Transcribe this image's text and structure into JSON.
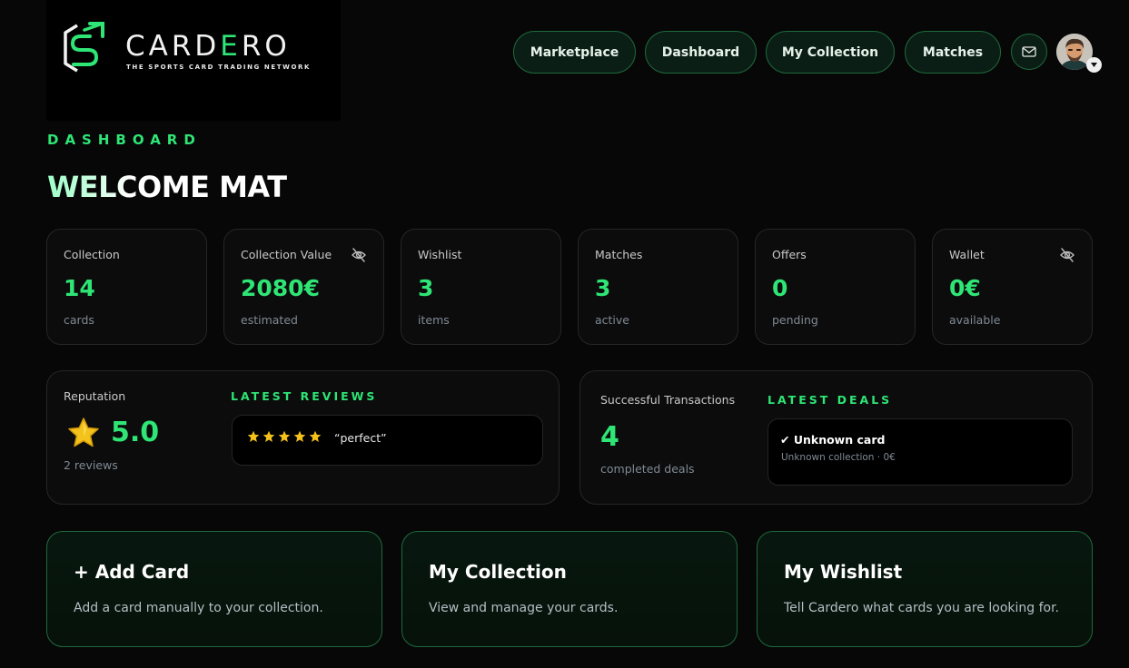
{
  "brand": {
    "name_prefix": "CARD",
    "name_accent": "E",
    "name_suffix": "RO",
    "tagline": "THE SPORTS CARD TRADING NETWORK",
    "accent_color": "#2ee575"
  },
  "nav": {
    "items": [
      {
        "label": "Marketplace"
      },
      {
        "label": "Dashboard"
      },
      {
        "label": "My Collection"
      },
      {
        "label": "Matches"
      }
    ],
    "mail_icon": "mail-icon",
    "avatar_icon": "user-avatar"
  },
  "header": {
    "eyebrow": "DASHBOARD",
    "welcome": "WELCOME MAT"
  },
  "stats": [
    {
      "label": "Collection",
      "value": "14",
      "sub": "cards",
      "icon": null
    },
    {
      "label": "Collection Value",
      "value": "2080€",
      "sub": "estimated",
      "icon": "eye-off-icon"
    },
    {
      "label": "Wishlist",
      "value": "3",
      "sub": "items",
      "icon": null
    },
    {
      "label": "Matches",
      "value": "3",
      "sub": "active",
      "icon": null
    },
    {
      "label": "Offers",
      "value": "0",
      "sub": "pending",
      "icon": null
    },
    {
      "label": "Wallet",
      "value": "0€",
      "sub": "available",
      "icon": "eye-off-icon"
    }
  ],
  "reputation": {
    "label": "Reputation",
    "value": "5.0",
    "sub": "2 reviews",
    "reviews_heading": "LATEST REVIEWS",
    "reviews": [
      {
        "rating": 5,
        "text": "“perfect”"
      }
    ]
  },
  "transactions": {
    "label": "Successful Transactions",
    "value": "4",
    "sub": "completed deals",
    "deals_heading": "LATEST DEALS",
    "deals": [
      {
        "title": "✔ Unknown card",
        "subtitle": "Unknown collection · 0€"
      }
    ]
  },
  "actions": [
    {
      "title": "+ Add Card",
      "description": "Add a card manually to your collection."
    },
    {
      "title": "My Collection",
      "description": "View and manage your cards."
    },
    {
      "title": "My Wishlist",
      "description": "Tell Cardero what cards you are looking for."
    }
  ]
}
